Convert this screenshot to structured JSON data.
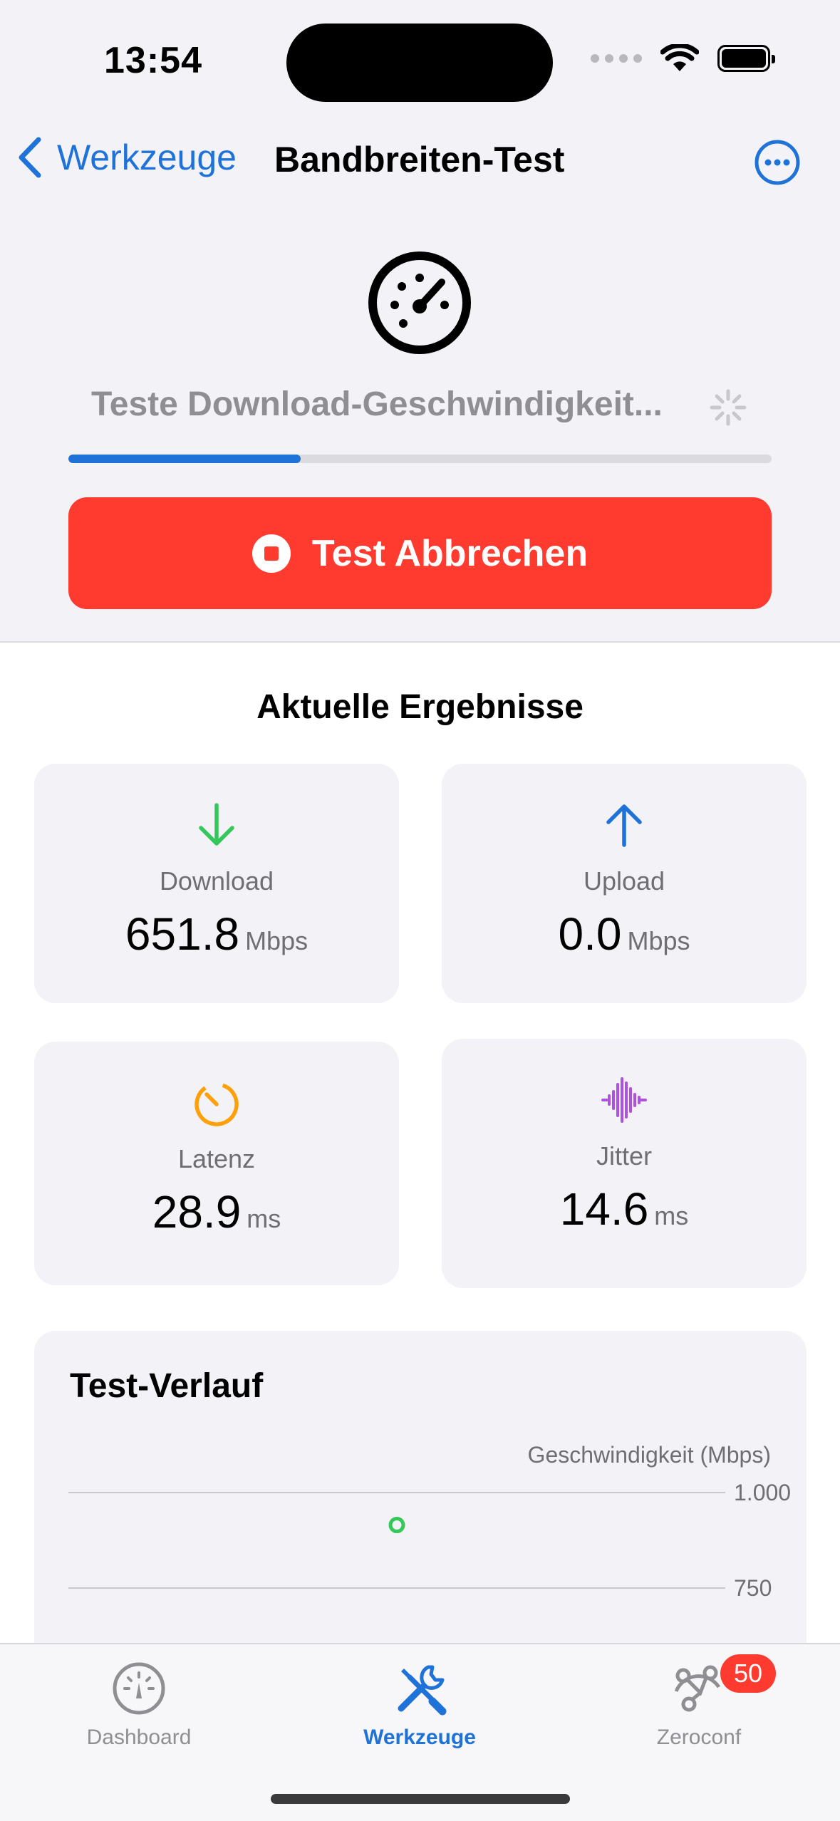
{
  "status_bar": {
    "time": "13:54"
  },
  "nav": {
    "back_label": "Werkzeuge",
    "title": "Bandbreiten-Test"
  },
  "test": {
    "status_message": "Teste Download-Geschwindigkeit...",
    "progress": 0.33,
    "cancel_label": "Test Abbrechen"
  },
  "results": {
    "title": "Aktuelle Ergebnisse",
    "download": {
      "label": "Download",
      "value": "651.8",
      "unit": "Mbps",
      "color": "#34c759"
    },
    "upload": {
      "label": "Upload",
      "value": "0.0",
      "unit": "Mbps",
      "color": "#1f72d8"
    },
    "latency": {
      "label": "Latenz",
      "value": "28.9",
      "unit": "ms",
      "color": "#ff9f0a"
    },
    "jitter": {
      "label": "Jitter",
      "value": "14.6",
      "unit": "ms",
      "color": "#af52de"
    }
  },
  "history": {
    "title": "Test-Verlauf",
    "chart_data": {
      "type": "scatter",
      "ylabel": "Geschwindigkeit (Mbps)",
      "y_ticks": [
        "1.000",
        "750"
      ],
      "y_visible_range": [
        750,
        1000
      ],
      "series": [
        {
          "values": [
            {
              "x": 0.5,
              "y": 915
            }
          ],
          "color": "#34c759"
        }
      ]
    }
  },
  "tabbar": {
    "dashboard": "Dashboard",
    "tools": "Werkzeuge",
    "zeroconf": "Zeroconf",
    "zeroconf_badge": "50"
  },
  "colors": {
    "accent": "#1f72d8",
    "danger": "#ff3b30"
  }
}
